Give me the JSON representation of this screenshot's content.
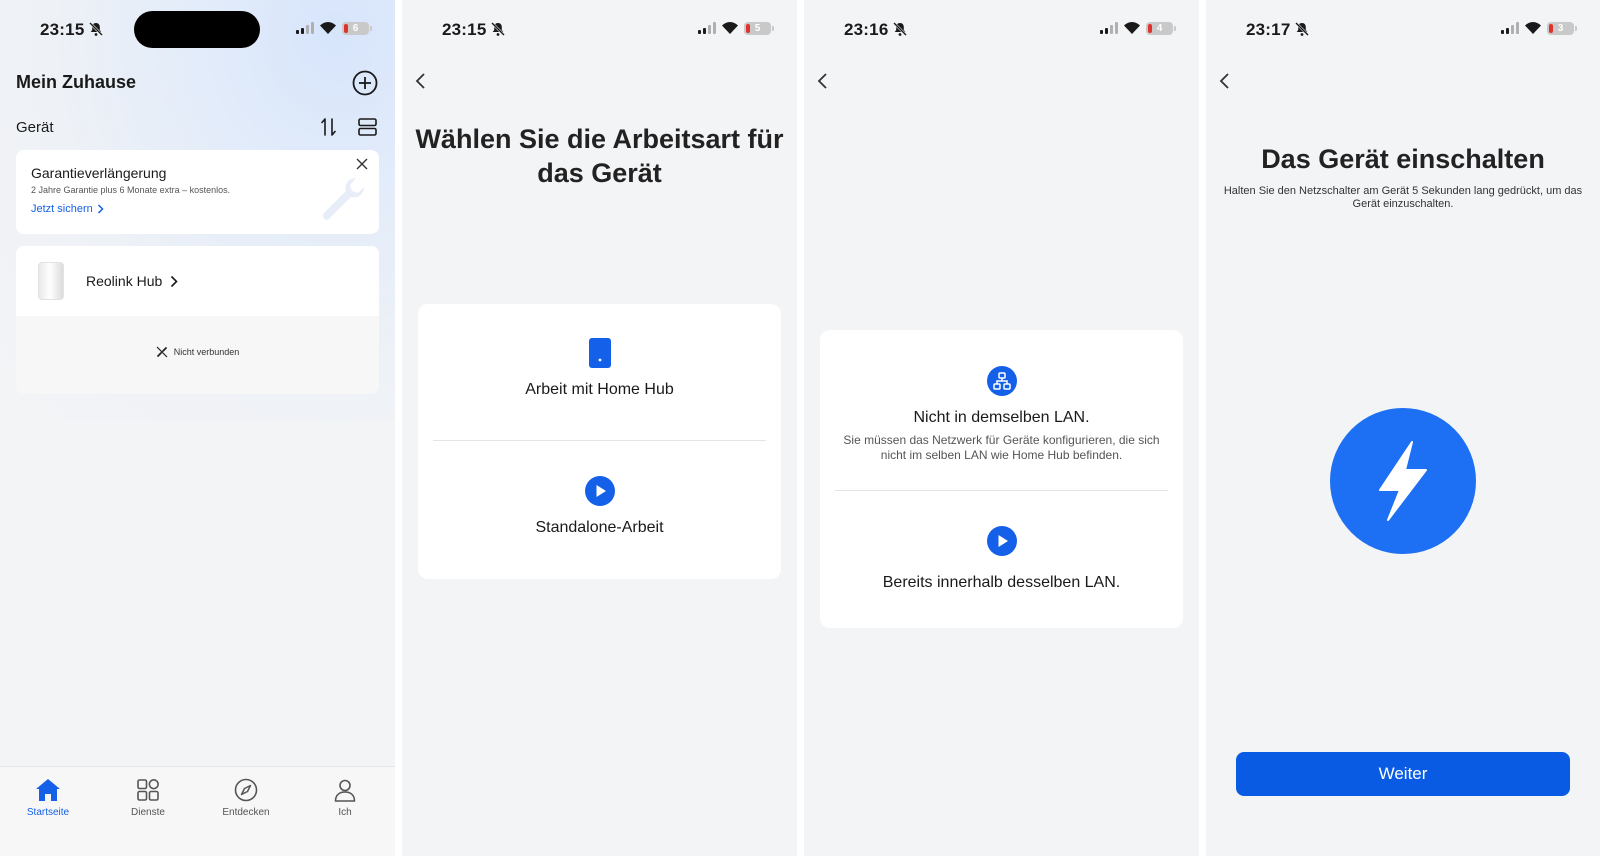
{
  "screens": [
    {
      "status": {
        "time": "23:15",
        "battery": "6"
      },
      "home": {
        "title": "Mein Zuhause",
        "add_icon": "plus-circle-icon",
        "section_title": "Gerät",
        "sort_icon": "sort-icon",
        "layout_icon": "layout-list-icon"
      },
      "promo": {
        "title": "Garantieverlängerung",
        "subtitle": "2 Jahre Garantie plus 6 Monate extra – kostenlos.",
        "link": "Jetzt sichern"
      },
      "device": {
        "name": "Reolink Hub",
        "status": "Nicht verbunden"
      },
      "tabs": [
        {
          "label": "Startseite",
          "icon": "home-icon",
          "active": true
        },
        {
          "label": "Dienste",
          "icon": "grid-icon",
          "active": false
        },
        {
          "label": "Entdecken",
          "icon": "compass-icon",
          "active": false
        },
        {
          "label": "Ich",
          "icon": "person-icon",
          "active": false
        }
      ]
    },
    {
      "status": {
        "time": "23:15",
        "battery": "5"
      },
      "title": "Wählen Sie die Arbeitsart für das Gerät",
      "options": [
        {
          "label": "Arbeit mit Home Hub",
          "icon": "hub-device-icon"
        },
        {
          "label": "Standalone-Arbeit",
          "icon": "play-circle-icon"
        }
      ]
    },
    {
      "status": {
        "time": "23:16",
        "battery": "4"
      },
      "options": [
        {
          "label": "Nicht in demselben LAN.",
          "description": "Sie müssen das Netzwerk für Geräte konfigurieren, die sich nicht im selben LAN wie Home Hub befinden.",
          "icon": "network-icon"
        },
        {
          "label": "Bereits innerhalb desselben LAN.",
          "icon": "play-circle-icon"
        }
      ]
    },
    {
      "status": {
        "time": "23:17",
        "battery": "3"
      },
      "title": "Das Gerät einschalten",
      "subtitle": "Halten Sie den Netzschalter am Gerät 5 Sekunden lang gedrückt, um das Gerät einzuschalten.",
      "icon": "power-bolt-icon",
      "button": "Weiter"
    }
  ],
  "colors": {
    "accent": "#1560e8",
    "button": "#0a5be3",
    "power": "#1d6ff3",
    "background": "#f3f4f6"
  }
}
